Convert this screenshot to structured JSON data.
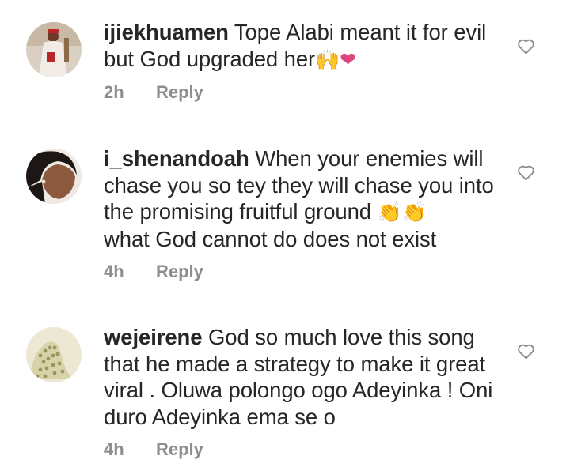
{
  "comments": [
    {
      "username": "ijiekhuamen",
      "text": "Tope Alabi meant it for evil but God upgraded her",
      "emoji_1": "🙌",
      "emoji_2": "❤",
      "time": "2h",
      "reply_label": "Reply",
      "avatar_icon": "avatar-photo",
      "like_icon": "heart-outline-icon"
    },
    {
      "username": "i_shenandoah",
      "text": "When your enemies will chase you so tey they will chase you into the promising fruitful ground",
      "emoji_1": "👏",
      "emoji_2": "👏",
      "text_after": "what God cannot do does not exist",
      "time": "4h",
      "reply_label": "Reply",
      "avatar_icon": "avatar-photo",
      "like_icon": "heart-outline-icon"
    },
    {
      "username": "wejeirene",
      "text": "God so much love this song that he made a strategy to make it great viral . Oluwa  polongo ogo Adeyinka ! Oni duro Adeyinka ema se o",
      "time": "4h",
      "reply_label": "Reply",
      "avatar_icon": "avatar-photo",
      "like_icon": "heart-outline-icon"
    }
  ],
  "colors": {
    "text": "#262626",
    "meta": "#8e8e8e",
    "emoji_hands": "#f5b700",
    "emoji_heart": "#e0447c"
  }
}
